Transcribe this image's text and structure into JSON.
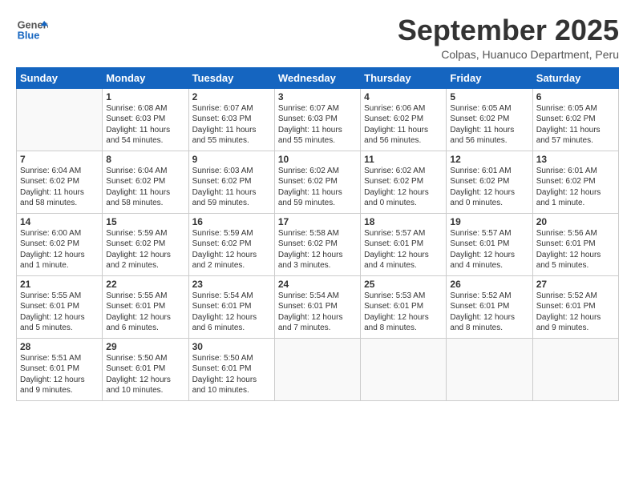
{
  "header": {
    "logo_general": "General",
    "logo_blue": "Blue",
    "month_title": "September 2025",
    "location": "Colpas, Huanuco Department, Peru"
  },
  "weekdays": [
    "Sunday",
    "Monday",
    "Tuesday",
    "Wednesday",
    "Thursday",
    "Friday",
    "Saturday"
  ],
  "weeks": [
    [
      {
        "day": "",
        "sunrise": "",
        "sunset": "",
        "daylight": ""
      },
      {
        "day": "1",
        "sunrise": "6:08 AM",
        "sunset": "6:03 PM",
        "daylight": "11 hours and 54 minutes."
      },
      {
        "day": "2",
        "sunrise": "6:07 AM",
        "sunset": "6:03 PM",
        "daylight": "11 hours and 55 minutes."
      },
      {
        "day": "3",
        "sunrise": "6:07 AM",
        "sunset": "6:03 PM",
        "daylight": "11 hours and 55 minutes."
      },
      {
        "day": "4",
        "sunrise": "6:06 AM",
        "sunset": "6:02 PM",
        "daylight": "11 hours and 56 minutes."
      },
      {
        "day": "5",
        "sunrise": "6:05 AM",
        "sunset": "6:02 PM",
        "daylight": "11 hours and 56 minutes."
      },
      {
        "day": "6",
        "sunrise": "6:05 AM",
        "sunset": "6:02 PM",
        "daylight": "11 hours and 57 minutes."
      }
    ],
    [
      {
        "day": "7",
        "sunrise": "6:04 AM",
        "sunset": "6:02 PM",
        "daylight": "11 hours and 58 minutes."
      },
      {
        "day": "8",
        "sunrise": "6:04 AM",
        "sunset": "6:02 PM",
        "daylight": "11 hours and 58 minutes."
      },
      {
        "day": "9",
        "sunrise": "6:03 AM",
        "sunset": "6:02 PM",
        "daylight": "11 hours and 59 minutes."
      },
      {
        "day": "10",
        "sunrise": "6:02 AM",
        "sunset": "6:02 PM",
        "daylight": "11 hours and 59 minutes."
      },
      {
        "day": "11",
        "sunrise": "6:02 AM",
        "sunset": "6:02 PM",
        "daylight": "12 hours and 0 minutes."
      },
      {
        "day": "12",
        "sunrise": "6:01 AM",
        "sunset": "6:02 PM",
        "daylight": "12 hours and 0 minutes."
      },
      {
        "day": "13",
        "sunrise": "6:01 AM",
        "sunset": "6:02 PM",
        "daylight": "12 hours and 1 minute."
      }
    ],
    [
      {
        "day": "14",
        "sunrise": "6:00 AM",
        "sunset": "6:02 PM",
        "daylight": "12 hours and 1 minute."
      },
      {
        "day": "15",
        "sunrise": "5:59 AM",
        "sunset": "6:02 PM",
        "daylight": "12 hours and 2 minutes."
      },
      {
        "day": "16",
        "sunrise": "5:59 AM",
        "sunset": "6:02 PM",
        "daylight": "12 hours and 2 minutes."
      },
      {
        "day": "17",
        "sunrise": "5:58 AM",
        "sunset": "6:02 PM",
        "daylight": "12 hours and 3 minutes."
      },
      {
        "day": "18",
        "sunrise": "5:57 AM",
        "sunset": "6:01 PM",
        "daylight": "12 hours and 4 minutes."
      },
      {
        "day": "19",
        "sunrise": "5:57 AM",
        "sunset": "6:01 PM",
        "daylight": "12 hours and 4 minutes."
      },
      {
        "day": "20",
        "sunrise": "5:56 AM",
        "sunset": "6:01 PM",
        "daylight": "12 hours and 5 minutes."
      }
    ],
    [
      {
        "day": "21",
        "sunrise": "5:55 AM",
        "sunset": "6:01 PM",
        "daylight": "12 hours and 5 minutes."
      },
      {
        "day": "22",
        "sunrise": "5:55 AM",
        "sunset": "6:01 PM",
        "daylight": "12 hours and 6 minutes."
      },
      {
        "day": "23",
        "sunrise": "5:54 AM",
        "sunset": "6:01 PM",
        "daylight": "12 hours and 6 minutes."
      },
      {
        "day": "24",
        "sunrise": "5:54 AM",
        "sunset": "6:01 PM",
        "daylight": "12 hours and 7 minutes."
      },
      {
        "day": "25",
        "sunrise": "5:53 AM",
        "sunset": "6:01 PM",
        "daylight": "12 hours and 8 minutes."
      },
      {
        "day": "26",
        "sunrise": "5:52 AM",
        "sunset": "6:01 PM",
        "daylight": "12 hours and 8 minutes."
      },
      {
        "day": "27",
        "sunrise": "5:52 AM",
        "sunset": "6:01 PM",
        "daylight": "12 hours and 9 minutes."
      }
    ],
    [
      {
        "day": "28",
        "sunrise": "5:51 AM",
        "sunset": "6:01 PM",
        "daylight": "12 hours and 9 minutes."
      },
      {
        "day": "29",
        "sunrise": "5:50 AM",
        "sunset": "6:01 PM",
        "daylight": "12 hours and 10 minutes."
      },
      {
        "day": "30",
        "sunrise": "5:50 AM",
        "sunset": "6:01 PM",
        "daylight": "12 hours and 10 minutes."
      },
      {
        "day": "",
        "sunrise": "",
        "sunset": "",
        "daylight": ""
      },
      {
        "day": "",
        "sunrise": "",
        "sunset": "",
        "daylight": ""
      },
      {
        "day": "",
        "sunrise": "",
        "sunset": "",
        "daylight": ""
      },
      {
        "day": "",
        "sunrise": "",
        "sunset": "",
        "daylight": ""
      }
    ]
  ]
}
